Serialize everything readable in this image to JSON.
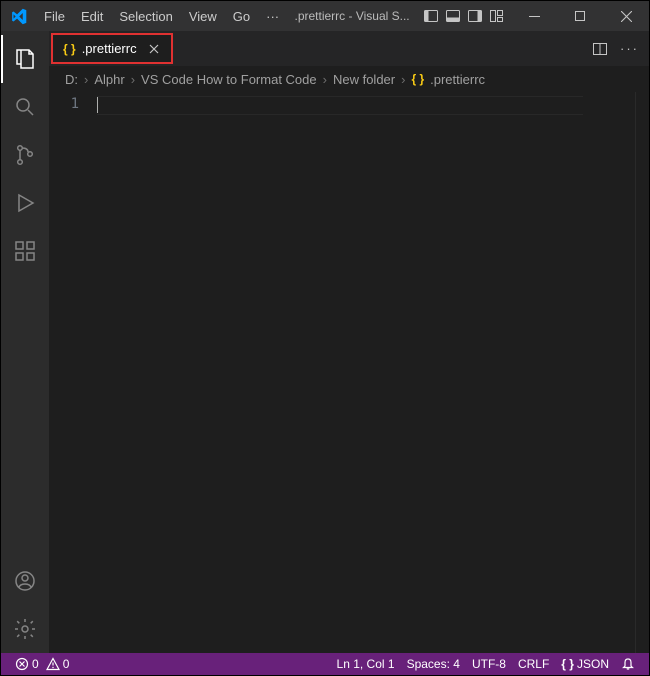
{
  "titlebar": {
    "menu": [
      "File",
      "Edit",
      "Selection",
      "View",
      "Go",
      "···"
    ],
    "title": ".prettierrc - Visual S..."
  },
  "activitybar": {
    "items": [
      {
        "name": "explorer",
        "active": true
      },
      {
        "name": "search",
        "active": false
      },
      {
        "name": "source-control",
        "active": false
      },
      {
        "name": "run-debug",
        "active": false
      },
      {
        "name": "extensions",
        "active": false
      }
    ],
    "bottom": [
      {
        "name": "accounts"
      },
      {
        "name": "settings"
      }
    ]
  },
  "tab": {
    "icon_text": "{ }",
    "filename": ".prettierrc"
  },
  "breadcrumbs": {
    "parts": [
      "D:",
      "Alphr",
      "VS Code How to Format Code",
      "New folder"
    ],
    "file_icon": "{ }",
    "file": ".prettierrc"
  },
  "editor": {
    "line_numbers": [
      "1"
    ],
    "content": ""
  },
  "statusbar": {
    "errors": "0",
    "warnings": "0",
    "cursor": "Ln 1, Col 1",
    "spaces": "Spaces: 4",
    "encoding": "UTF-8",
    "eol": "CRLF",
    "lang_icon": "{ }",
    "lang": "JSON"
  }
}
